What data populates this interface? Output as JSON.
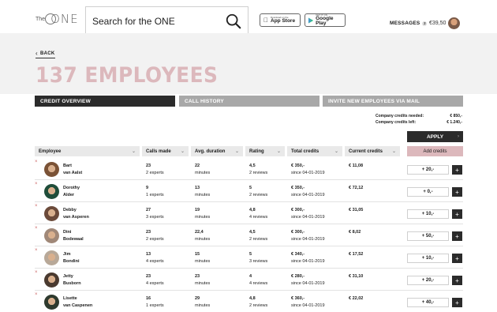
{
  "header": {
    "logo_the": "The",
    "logo_one": "ONE",
    "search_placeholder": "Search for the ONE",
    "app_store_small": "Download on the",
    "app_store_big": "App Store",
    "google_play_small": "GET IT ON",
    "google_play_big": "Google Play",
    "messages_label": "MESSAGES",
    "messages_count": "2",
    "balance": "€39,50"
  },
  "page": {
    "back_label": "BACK",
    "title": "137 EMPLOYEES"
  },
  "tabs": [
    {
      "label": "CREDIT OVERVIEW"
    },
    {
      "label": "CALL HISTORY"
    },
    {
      "label": "INVITE NEW EMPLOYEES VIA MAIL"
    }
  ],
  "credits_summary": {
    "needed_label": "Company credits needed:",
    "needed_value": "€ 850,-",
    "left_label": "Company credits left:",
    "left_value": "€ 1.240,-"
  },
  "apply_label": "APPLY",
  "table": {
    "headers": [
      "Employee",
      "Calls made",
      "Avg. duration",
      "Rating",
      "Total credits",
      "Current credits"
    ],
    "add_credits_label": "Add credits",
    "rows": [
      {
        "first": "Bart",
        "last": "van Aalst",
        "calls": "23",
        "calls_sub": "2 experts",
        "duration": "22",
        "duration_sub": "minutes",
        "rating": "4,5",
        "rating_sub": "2 reviews",
        "total": "€ 350,-",
        "total_sub": "since 04-01-2019",
        "current": "€ 11,08",
        "add": "+ 20,-"
      },
      {
        "first": "Dorothy",
        "last": "Alder",
        "calls": "9",
        "calls_sub": "1 experts",
        "duration": "13",
        "duration_sub": "minutes",
        "rating": "5",
        "rating_sub": "2 reviews",
        "total": "€ 350,-",
        "total_sub": "since 04-01-2019",
        "current": "€ 72,12",
        "add": "+ 0,-"
      },
      {
        "first": "Debby",
        "last": "van Asperen",
        "calls": "27",
        "calls_sub": "3 experts",
        "duration": "19",
        "duration_sub": "minutes",
        "rating": "4,8",
        "rating_sub": "4 reviews",
        "total": "€ 300,-",
        "total_sub": "since 04-01-2019",
        "current": "€ 31,05",
        "add": "+ 10,-"
      },
      {
        "first": "Dini",
        "last": "Bodewaal",
        "calls": "23",
        "calls_sub": "2 experts",
        "duration": "22,4",
        "duration_sub": "minutes",
        "rating": "4,5",
        "rating_sub": "2 reviews",
        "total": "€ 300,-",
        "total_sub": "since 04-01-2019",
        "current": "€ 8,02",
        "add": "+ 50,-"
      },
      {
        "first": "Jim",
        "last": "Bondini",
        "calls": "13",
        "calls_sub": "4 experts",
        "duration": "15",
        "duration_sub": "minutes",
        "rating": "5",
        "rating_sub": "3 reviews",
        "total": "€ 340,-",
        "total_sub": "since 04-01-2019",
        "current": "€ 17,52",
        "add": "+ 10,-"
      },
      {
        "first": "Jetty",
        "last": "Busborn",
        "calls": "23",
        "calls_sub": "4 experts",
        "duration": "23",
        "duration_sub": "minutes",
        "rating": "4",
        "rating_sub": "4 reviews",
        "total": "€ 280,-",
        "total_sub": "since 04-01-2019",
        "current": "€ 31,10",
        "add": "+ 20,-"
      },
      {
        "first": "Lisette",
        "last": "van Caspenen",
        "calls": "16",
        "calls_sub": "1 experts",
        "duration": "29",
        "duration_sub": "minutes",
        "rating": "4,8",
        "rating_sub": "2 reviews",
        "total": "€ 360,-",
        "total_sub": "since 04-01-2019",
        "current": "€ 22,02",
        "add": "+ 40,-"
      }
    ]
  },
  "colors": {
    "accent_pink": "#dcb8bc",
    "dark": "#2b2b2b",
    "tab_inactive": "#a8a8a8"
  }
}
